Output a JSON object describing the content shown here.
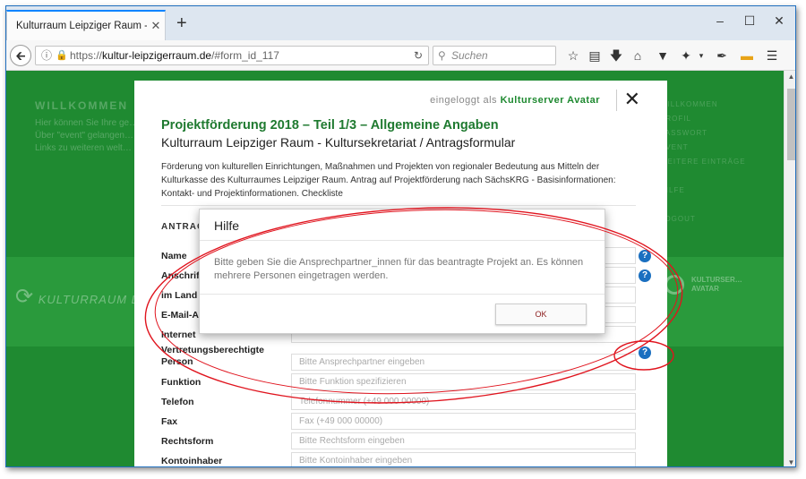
{
  "browser": {
    "tab_title": "Kulturraum Leipziger Raum - Kul",
    "tab_close": "✕",
    "new_tab": "+",
    "window_controls": {
      "minimize": "–",
      "maximize": "☐",
      "close": "✕"
    },
    "url_scheme": "https://",
    "url_host": "kultur-leipzigerraum.de",
    "url_path": "/#form_id_117",
    "search_placeholder": "Suchen",
    "icons": [
      "star-icon",
      "reading-list-icon",
      "download-icon",
      "home-icon",
      "pocket-icon",
      "extensions-icon",
      "pen-icon",
      "note-icon",
      "menu-icon"
    ]
  },
  "background": {
    "welcome": "WILLKOMMEN",
    "lines": [
      "Hier können Sie Ihre ge…",
      "Über \"event\" gelangen…",
      "Links zu weiteren  welt…"
    ],
    "right_menu": [
      "WILLKOMMEN",
      "PROFIL",
      "PASSWORT",
      "EVENT",
      "WEITERE EINTRÄGE",
      "HILFE",
      "LOGOUT"
    ],
    "logo_text": "KULTURRAUM L",
    "avatar_text": [
      "KULTURSER…",
      "AVATAR"
    ]
  },
  "modal": {
    "login_prefix": "eingeloggt als",
    "login_user": "Kulturserver Avatar",
    "close": "✕",
    "title": "Projektförderung 2018 – Teil 1/3 – Allgemeine Angaben",
    "subtitle": "Kulturraum Leipziger Raum - Kultursekretariat / Antragsformular",
    "description": "Förderung von kulturellen Einrichtungen, Maßnahmen und Projekten von regionaler Bedeutung aus Mitteln der Kulturkasse des Kulturraumes Leipziger Raum. Antrag auf Projektförderung nach SächsKRG - Basisinformationen: Kontakt- und Projektinformationen. Checkliste",
    "section_heading": "ANTRAG",
    "fields": [
      {
        "label": "Name",
        "placeholder": ""
      },
      {
        "label": "Anschrift",
        "placeholder": ""
      },
      {
        "label": "im Land",
        "placeholder": ""
      },
      {
        "label": "E-Mail-A",
        "placeholder": ""
      },
      {
        "label": "Internet",
        "placeholder": ""
      },
      {
        "label": "Vertretungsberechtigte",
        "placeholder": ""
      },
      {
        "label": "Person",
        "placeholder": "Bitte Ansprechpartner eingeben"
      },
      {
        "label": "Funktion",
        "placeholder": "Bitte Funktion spezifizieren"
      },
      {
        "label": "Telefon",
        "placeholder": "Telefonnummer (+49 000 00000)"
      },
      {
        "label": "Fax",
        "placeholder": "Fax (+49 000 00000)"
      },
      {
        "label": "Rechtsform",
        "placeholder": "Bitte Rechtsform eingeben"
      },
      {
        "label": "Kontoinhaber",
        "placeholder": "Bitte Kontoinhaber eingeben"
      }
    ],
    "help_glyph": "?"
  },
  "dialog": {
    "title": "Hilfe",
    "body": "Bitte geben Sie die Ansprechpartner_innen für das beantragte Projekt an. Es können mehrere Personen eingetragen werden.",
    "ok_label": "OK"
  },
  "colors": {
    "site_green": "#1f8a31",
    "title_green": "#1f7a30",
    "help_blue": "#1a6fc0",
    "annotation_red": "#e0141e"
  }
}
